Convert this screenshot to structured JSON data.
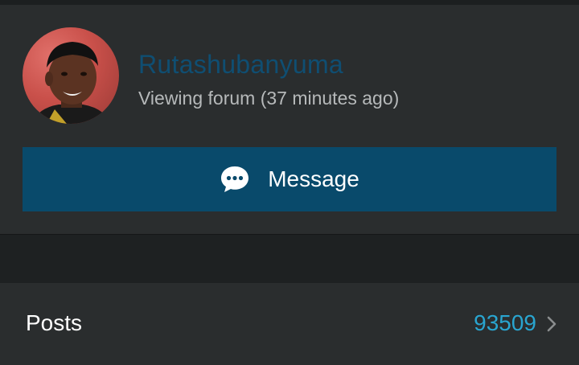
{
  "profile": {
    "username": "Rutashubanyuma",
    "status": "Viewing forum (37 minutes ago)",
    "avatar_icon": "user-avatar-photo"
  },
  "actions": {
    "message_label": "Message",
    "message_icon": "chat-bubble-icon"
  },
  "stats": {
    "posts_label": "Posts",
    "posts_value": "93509",
    "chevron_icon": "chevron-right-icon"
  },
  "colors": {
    "background": "#1e2122",
    "card": "#2a2d2e",
    "username": "#0f4e72",
    "button": "#094a6b",
    "stat_value": "#29a5d0"
  }
}
